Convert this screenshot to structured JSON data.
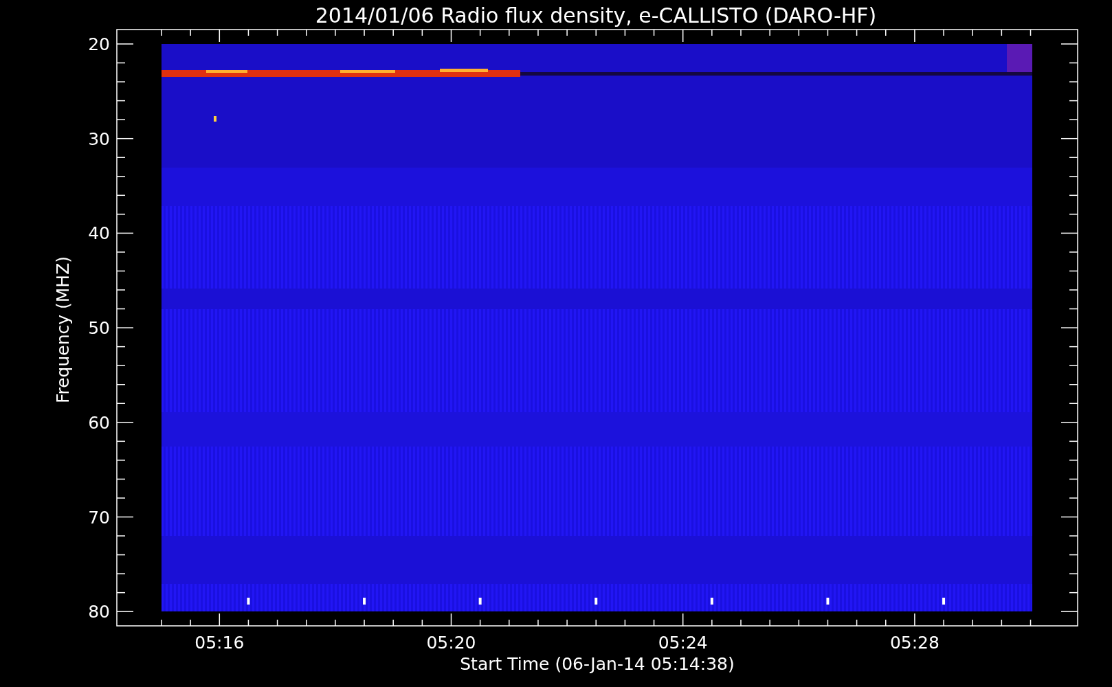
{
  "title": "2014/01/06  Radio flux density, e-CALLISTO (DARO-HF)",
  "y_axis": {
    "label": "Frequency (MHZ)",
    "ticks": [
      "20",
      "30",
      "40",
      "50",
      "60",
      "70",
      "80"
    ]
  },
  "x_axis": {
    "label": "Start Time (06-Jan-14 05:14:38)",
    "ticks": [
      "05:16",
      "05:20",
      "05:24",
      "05:28"
    ]
  }
}
